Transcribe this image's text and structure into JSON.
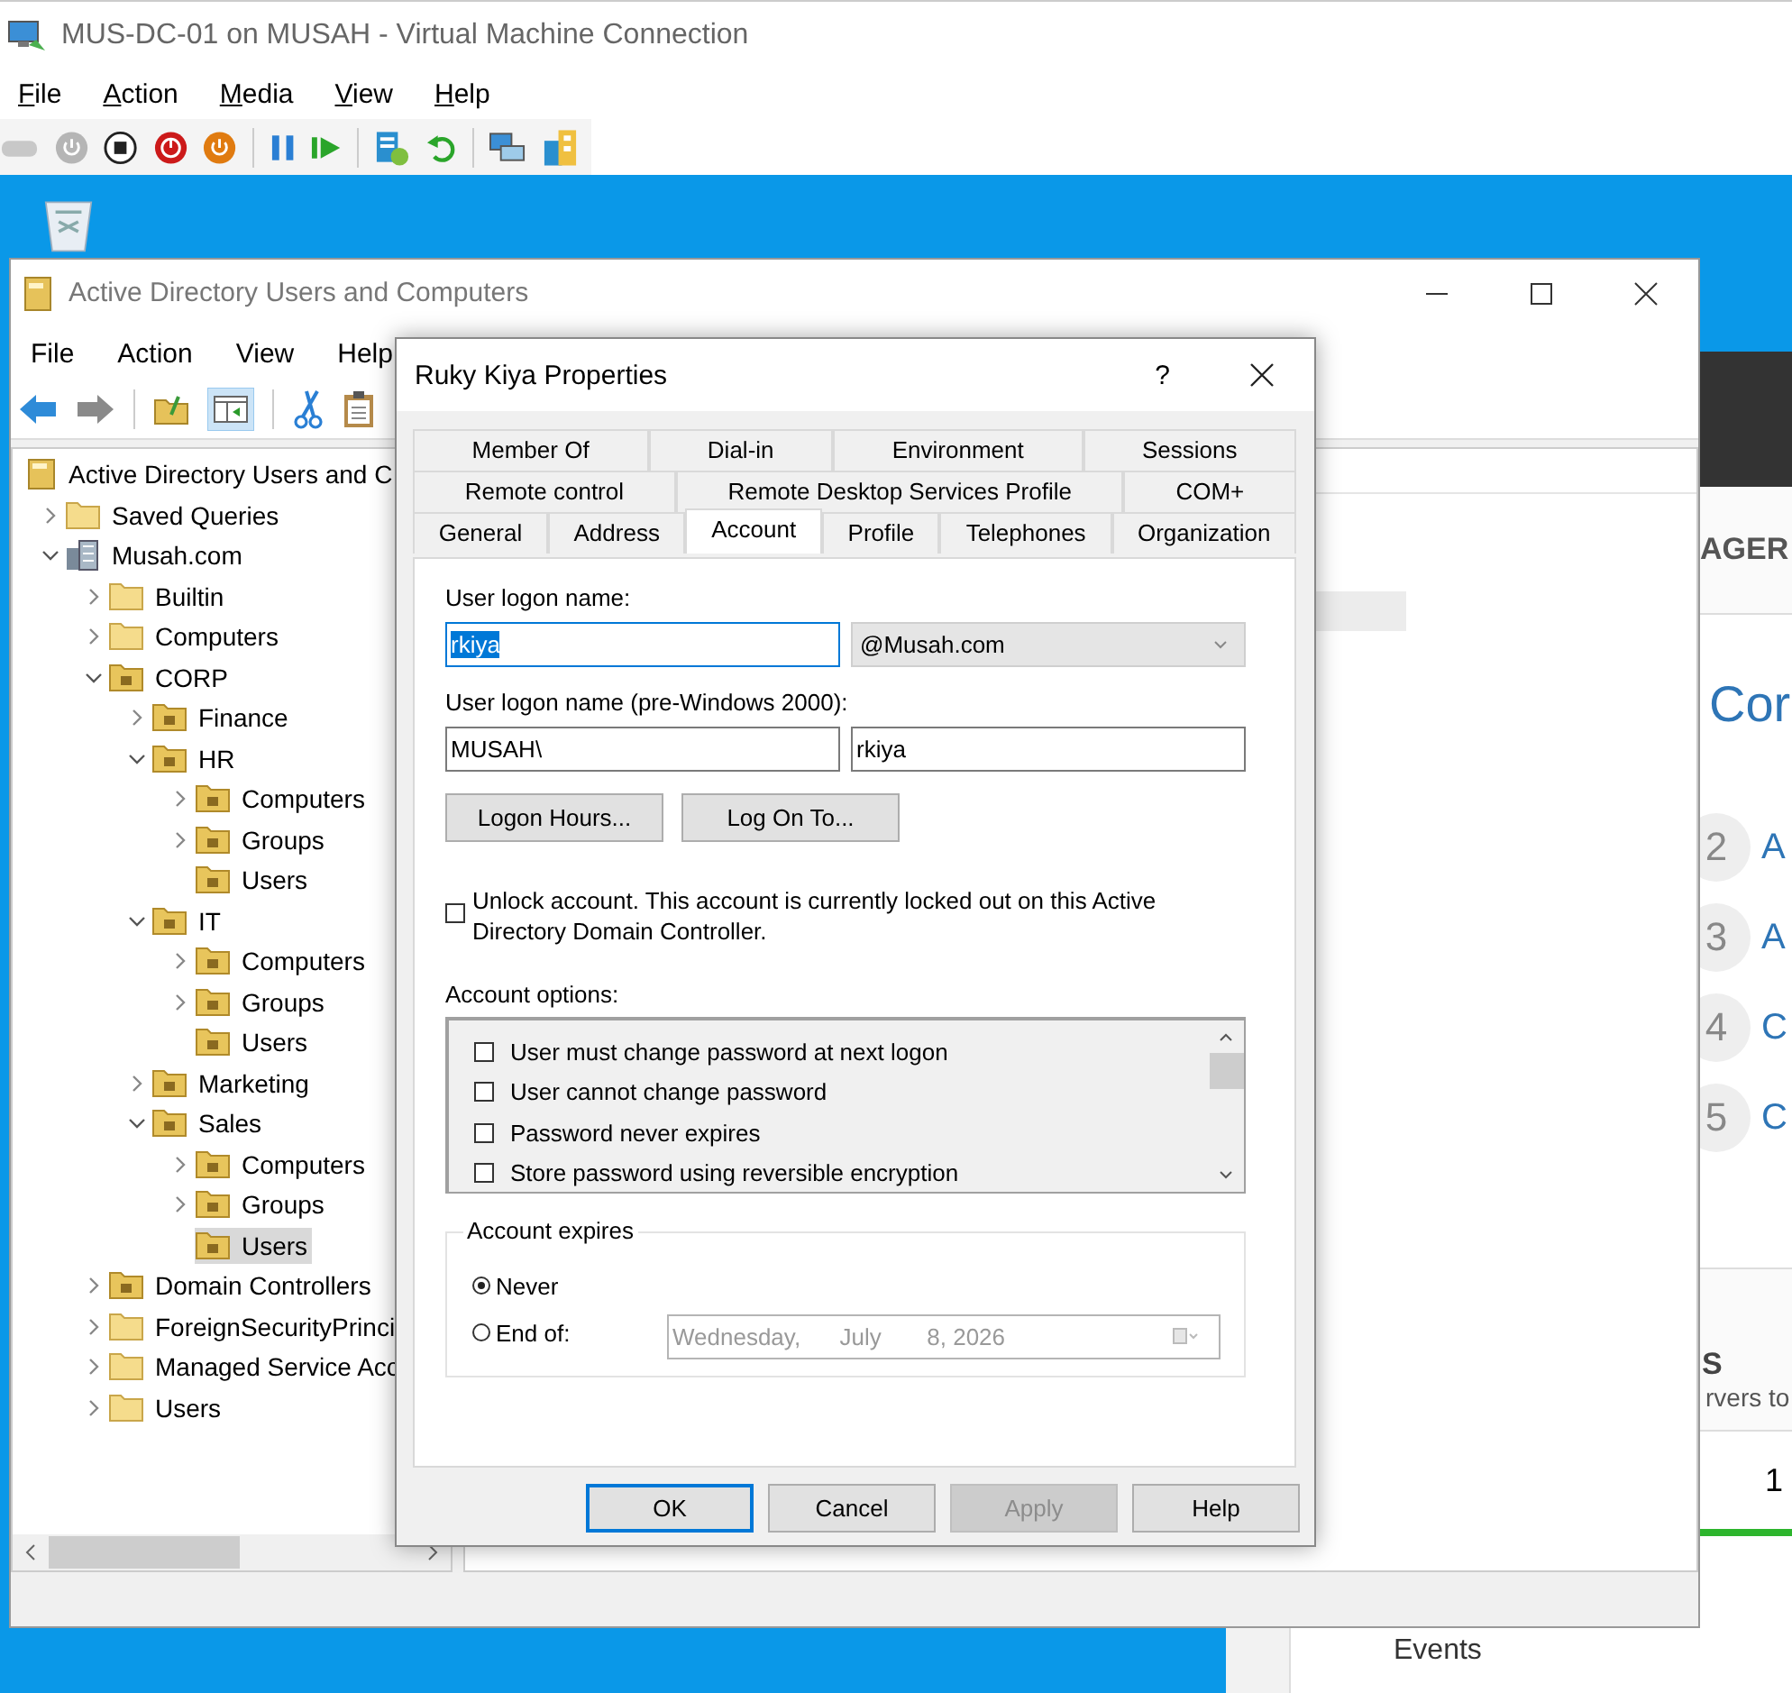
{
  "vm_window": {
    "title": "MUS-DC-01 on MUSAH - Virtual Machine Connection",
    "menu": [
      "File",
      "Action",
      "Media",
      "View",
      "Help"
    ]
  },
  "server_manager": {
    "header": "AGER",
    "heading": "Cor",
    "steps": [
      {
        "number": "2",
        "label": "A"
      },
      {
        "number": "3",
        "label": "A"
      },
      {
        "number": "4",
        "label": "C"
      },
      {
        "number": "5",
        "label": "C"
      }
    ],
    "tile_title": "S",
    "tile_subtitle": "rvers to",
    "tile_count": "1",
    "nav_item": "Events"
  },
  "aduc_window": {
    "title": "Active Directory Users and Computers",
    "menu": [
      "File",
      "Action",
      "View",
      "Help"
    ],
    "tree": [
      {
        "label": "Active Directory Users and C",
        "kind": "root",
        "selected": false,
        "children": [
          {
            "label": "Saved Queries",
            "kind": "query",
            "expanded": false,
            "selected": false
          },
          {
            "label": "Musah.com",
            "kind": "domain",
            "expanded": true,
            "selected": false,
            "children": [
              {
                "label": "Builtin",
                "kind": "container",
                "expanded": false,
                "selected": false
              },
              {
                "label": "Computers",
                "kind": "container",
                "expanded": false,
                "selected": false
              },
              {
                "label": "CORP",
                "kind": "ou",
                "expanded": true,
                "selected": false,
                "children": [
                  {
                    "label": "Finance",
                    "kind": "ou",
                    "expanded": false,
                    "selected": false
                  },
                  {
                    "label": "HR",
                    "kind": "ou",
                    "expanded": true,
                    "selected": false,
                    "children": [
                      {
                        "label": "Computers",
                        "kind": "ou",
                        "expanded": false,
                        "selected": false
                      },
                      {
                        "label": "Groups",
                        "kind": "ou",
                        "expanded": false,
                        "selected": false
                      },
                      {
                        "label": "Users",
                        "kind": "ou",
                        "selected": false
                      }
                    ]
                  },
                  {
                    "label": "IT",
                    "kind": "ou",
                    "expanded": true,
                    "selected": false,
                    "children": [
                      {
                        "label": "Computers",
                        "kind": "ou",
                        "expanded": false,
                        "selected": false
                      },
                      {
                        "label": "Groups",
                        "kind": "ou",
                        "expanded": false,
                        "selected": false
                      },
                      {
                        "label": "Users",
                        "kind": "ou",
                        "selected": false
                      }
                    ]
                  },
                  {
                    "label": "Marketing",
                    "kind": "ou",
                    "expanded": false,
                    "selected": false
                  },
                  {
                    "label": "Sales",
                    "kind": "ou",
                    "expanded": true,
                    "selected": false,
                    "children": [
                      {
                        "label": "Computers",
                        "kind": "ou",
                        "expanded": false,
                        "selected": false
                      },
                      {
                        "label": "Groups",
                        "kind": "ou",
                        "expanded": false,
                        "selected": false
                      },
                      {
                        "label": "Users",
                        "kind": "ou",
                        "selected": true
                      }
                    ]
                  }
                ]
              },
              {
                "label": "Domain Controllers",
                "kind": "ou",
                "expanded": false,
                "selected": false
              },
              {
                "label": "ForeignSecurityPrinci",
                "kind": "container",
                "expanded": false,
                "selected": false
              },
              {
                "label": "Managed Service Acc",
                "kind": "container",
                "expanded": false,
                "selected": false
              },
              {
                "label": "Users",
                "kind": "container",
                "expanded": false,
                "selected": false
              }
            ]
          }
        ]
      }
    ]
  },
  "dialog": {
    "title": "Ruky Kiya Properties",
    "help": "?",
    "tab_rows": [
      [
        {
          "label": "Member Of",
          "selected": false
        },
        {
          "label": "Dial-in",
          "selected": false
        },
        {
          "label": "Environment",
          "selected": false
        },
        {
          "label": "Sessions",
          "selected": false
        }
      ],
      [
        {
          "label": "Remote control",
          "selected": false
        },
        {
          "label": "Remote Desktop Services Profile",
          "selected": false
        },
        {
          "label": "COM+",
          "selected": false
        }
      ],
      [
        {
          "label": "General",
          "selected": false
        },
        {
          "label": "Address",
          "selected": false
        },
        {
          "label": "Account",
          "selected": true
        },
        {
          "label": "Profile",
          "selected": false
        },
        {
          "label": "Telephones",
          "selected": false
        },
        {
          "label": "Organization",
          "selected": false
        }
      ]
    ],
    "logon_name_label": "User logon name:",
    "logon_name": "rkiya",
    "logon_name_highlighted": true,
    "domain_suffix": "@Musah.com",
    "pre2000_label": "User logon name (pre-Windows 2000):",
    "pre2000_domain": "MUSAH\\",
    "pre2000_name": "rkiya",
    "action_buttons": [
      "Logon Hours...",
      "Log On To..."
    ],
    "unlock": {
      "label": "Unlock account. This account is currently locked out on this Active Directory Domain Controller.",
      "checked": false
    },
    "options_label": "Account options:",
    "options": [
      {
        "label": "User must change password at next logon",
        "checked": false
      },
      {
        "label": "User cannot change password",
        "checked": false
      },
      {
        "label": "Password never expires",
        "checked": false
      },
      {
        "label": "Store password using reversible encryption",
        "checked": false
      }
    ],
    "expires": {
      "legend": "Account expires",
      "choices": [
        {
          "label": "Never",
          "selected": true
        },
        {
          "label": "End of:",
          "selected": false
        }
      ],
      "date": "Wednesday,      July       8, 2026"
    },
    "buttons": [
      {
        "label": "OK",
        "default": true,
        "disabled": false
      },
      {
        "label": "Cancel",
        "default": false,
        "disabled": false
      },
      {
        "label": "Apply",
        "default": false,
        "disabled": true
      },
      {
        "label": "Help",
        "default": false,
        "disabled": false
      }
    ]
  }
}
